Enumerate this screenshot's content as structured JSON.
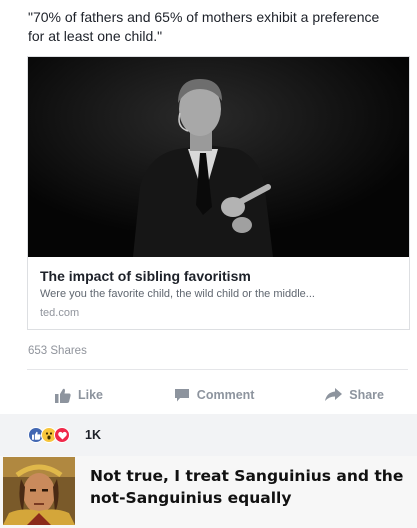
{
  "post": {
    "text": "\"70% of fathers and 65% of mothers exhibit a preference for at least one child.\""
  },
  "link": {
    "title": "The impact of sibling favoritism",
    "description": "Were you the favorite child, the wild child or the middle...",
    "domain": "ted.com"
  },
  "stats": {
    "shares": "653 Shares"
  },
  "actions": {
    "like": "Like",
    "comment": "Comment",
    "share": "Share"
  },
  "reactions": {
    "icons": [
      "like-reaction-icon",
      "wow-reaction-icon",
      "love-reaction-icon"
    ],
    "count": "1K"
  },
  "comment": {
    "text": "Not true, I treat Sanguinius and the not-Sanguinius equally"
  },
  "colors": {
    "like_blue": "#4267b2",
    "wow_yellow": "#f7c53c",
    "love_red": "#f0284a",
    "muted_gray": "#8d949e"
  }
}
